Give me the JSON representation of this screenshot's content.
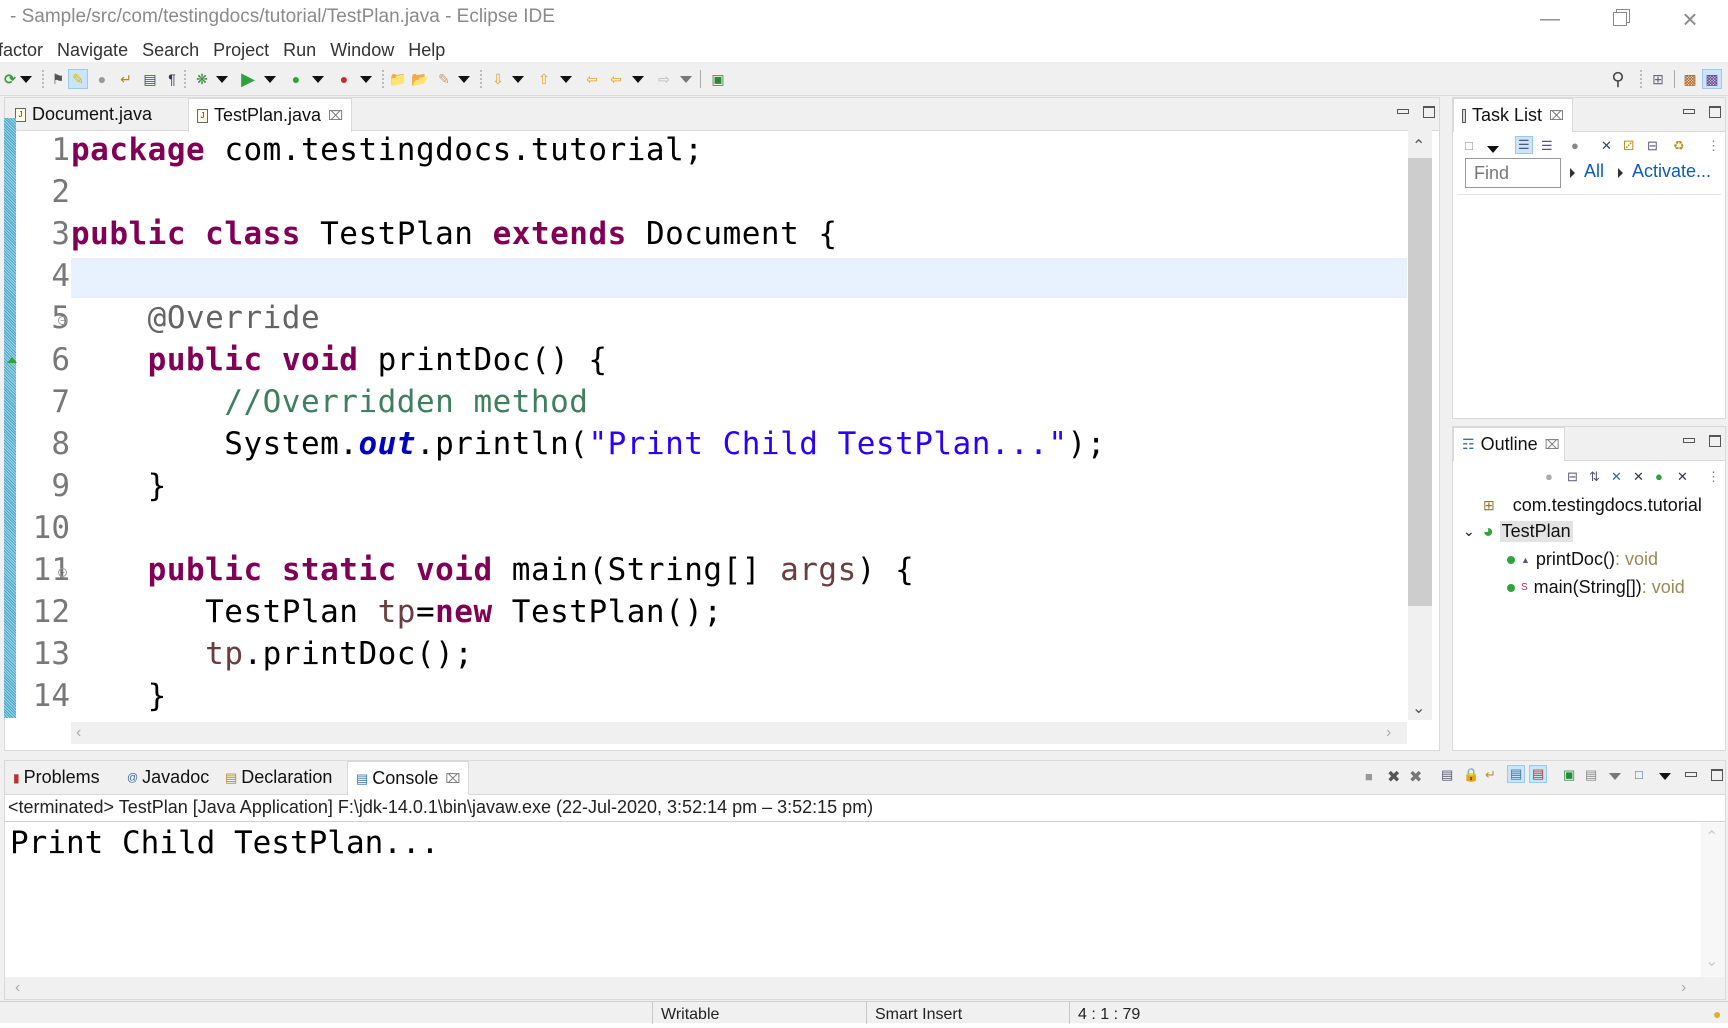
{
  "window": {
    "title": "- Sample/src/com/testingdocs/tutorial/TestPlan.java - Eclipse IDE",
    "controls": [
      "minimize",
      "restore",
      "close"
    ]
  },
  "menu": [
    "factor",
    "Navigate",
    "Search",
    "Project",
    "Run",
    "Window",
    "Help"
  ],
  "toolbar": {
    "icons": [
      "new-icon",
      "open-type-icon",
      "toggle-mark-occurrences-icon",
      "toggle-block-selection-icon",
      "next-annotation-icon",
      "show-whitespace-icon",
      "pilcrow-icon",
      "debug-icon",
      "run-icon",
      "coverage-icon",
      "external-tools-icon",
      "new-java-project-icon",
      "open-folder-icon",
      "search-icon",
      "next-edit-icon",
      "prev-edit-icon",
      "last-edit-location-icon",
      "back-icon",
      "forward-icon",
      "pin-editor-icon"
    ],
    "right_icons": [
      "search-icon",
      "open-perspective-icon",
      "java-ee-perspective-icon",
      "java-perspective-icon"
    ]
  },
  "editor": {
    "tabs": [
      {
        "label": "Document.java",
        "active": false
      },
      {
        "label": "TestPlan.java",
        "active": true,
        "closable": true
      }
    ],
    "current_line": 4,
    "lines": [
      {
        "n": "1",
        "tokens": [
          {
            "t": "package",
            "c": "kw"
          },
          {
            "t": " com.testingdocs.tutorial;",
            "c": ""
          }
        ]
      },
      {
        "n": "2",
        "tokens": []
      },
      {
        "n": "3",
        "tokens": [
          {
            "t": "public",
            "c": "kw"
          },
          {
            "t": " ",
            "c": ""
          },
          {
            "t": "class",
            "c": "kw"
          },
          {
            "t": " TestPlan ",
            "c": ""
          },
          {
            "t": "extends",
            "c": "kw"
          },
          {
            "t": " Document {",
            "c": ""
          }
        ]
      },
      {
        "n": "4",
        "tokens": []
      },
      {
        "n": "5",
        "fold": true,
        "tokens": [
          {
            "t": "    ",
            "c": ""
          },
          {
            "t": "@Override",
            "c": "ann"
          }
        ]
      },
      {
        "n": "6",
        "tokens": [
          {
            "t": "    ",
            "c": ""
          },
          {
            "t": "public",
            "c": "kw"
          },
          {
            "t": " ",
            "c": ""
          },
          {
            "t": "void",
            "c": "kw"
          },
          {
            "t": " printDoc() {",
            "c": ""
          }
        ]
      },
      {
        "n": "7",
        "tokens": [
          {
            "t": "        ",
            "c": ""
          },
          {
            "t": "//Overridden method",
            "c": "cm"
          }
        ]
      },
      {
        "n": "8",
        "tokens": [
          {
            "t": "        System.",
            "c": ""
          },
          {
            "t": "out",
            "c": "fld"
          },
          {
            "t": ".println(",
            "c": ""
          },
          {
            "t": "\"Print Child TestPlan...\"",
            "c": "str"
          },
          {
            "t": ");",
            "c": ""
          }
        ]
      },
      {
        "n": "9",
        "tokens": [
          {
            "t": "    }",
            "c": ""
          }
        ]
      },
      {
        "n": "10",
        "tokens": []
      },
      {
        "n": "11",
        "fold": true,
        "tokens": [
          {
            "t": "    ",
            "c": ""
          },
          {
            "t": "public",
            "c": "kw"
          },
          {
            "t": " ",
            "c": ""
          },
          {
            "t": "static",
            "c": "kw"
          },
          {
            "t": " ",
            "c": ""
          },
          {
            "t": "void",
            "c": "kw"
          },
          {
            "t": " main(String[] ",
            "c": ""
          },
          {
            "t": "args",
            "c": "var"
          },
          {
            "t": ") {",
            "c": ""
          }
        ]
      },
      {
        "n": "12",
        "tokens": [
          {
            "t": "       TestPlan ",
            "c": ""
          },
          {
            "t": "tp",
            "c": "var"
          },
          {
            "t": "=",
            "c": ""
          },
          {
            "t": "new",
            "c": "kw"
          },
          {
            "t": " TestPlan();",
            "c": ""
          }
        ]
      },
      {
        "n": "13",
        "tokens": [
          {
            "t": "       ",
            "c": ""
          },
          {
            "t": "tp",
            "c": "var"
          },
          {
            "t": ".printDoc();",
            "c": ""
          }
        ]
      },
      {
        "n": "14",
        "tokens": [
          {
            "t": "    }",
            "c": ""
          }
        ]
      }
    ]
  },
  "task_list": {
    "title": "Task List",
    "find_placeholder": "Find",
    "all_label": "All",
    "activate_label": "Activate..."
  },
  "outline": {
    "title": "Outline",
    "package": "com.testingdocs.tutorial",
    "class": "TestPlan",
    "members": [
      {
        "name": "printDoc()",
        "type": " : void",
        "modifier": "override"
      },
      {
        "name": "main(String[])",
        "type": " : void",
        "modifier": "static"
      }
    ]
  },
  "bottom": {
    "tabs": [
      {
        "label": "Problems",
        "active": false
      },
      {
        "label": "Javadoc",
        "active": false
      },
      {
        "label": "Declaration",
        "active": false
      },
      {
        "label": "Console",
        "active": true,
        "closable": true
      }
    ],
    "console_header": "<terminated> TestPlan [Java Application] F:\\jdk-14.0.1\\bin\\javaw.exe  (22-Jul-2020, 3:52:14 pm – 3:52:15 pm)",
    "console_output": "Print Child TestPlan..."
  },
  "status": {
    "writable": "Writable",
    "insert_mode": "Smart Insert",
    "position": "4 : 1 : 79"
  }
}
